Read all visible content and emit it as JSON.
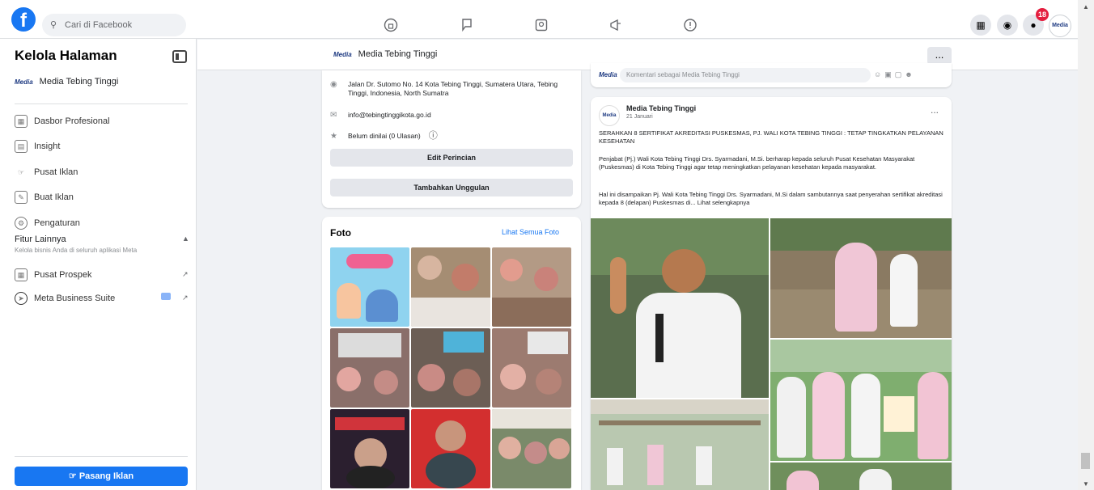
{
  "topbar": {
    "logo": "f",
    "search_placeholder": "Cari di Facebook",
    "profile_label": "Media",
    "notification_count": "18"
  },
  "sidebar": {
    "title": "Kelola Halaman",
    "page_name": "Media Tebing Tinggi",
    "page_logo_text": "Media",
    "items": [
      {
        "label": "Dasbor Profesional"
      },
      {
        "label": "Insight"
      },
      {
        "label": "Pusat Iklan"
      },
      {
        "label": "Buat Iklan"
      },
      {
        "label": "Pengaturan"
      }
    ],
    "section_title": "Fitur Lainnya",
    "section_subtitle": "Kelola bisnis Anda di seluruh aplikasi Meta",
    "extra_items": [
      {
        "label": "Pusat Prospek"
      },
      {
        "label": "Meta Business Suite"
      }
    ],
    "promote_button": "Pasang Iklan"
  },
  "page_bar": {
    "page_name": "Media Tebing Tinggi",
    "more_label": "..."
  },
  "intro": {
    "address": "Jalan Dr. Sutomo No. 14 Kota Tebing Tinggi, Sumatera Utara, Tebing Tinggi, Indonesia, North Sumatra",
    "email": "info@tebingtinggikota.go.id",
    "rating": "Belum dinilai (0 Ulasan)",
    "edit_button": "Edit Perincian",
    "add_featured_button": "Tambahkan Unggulan"
  },
  "photos": {
    "title": "Foto",
    "see_all": "Lihat Semua Foto"
  },
  "composer": {
    "placeholder": "Komentari sebagai Media Tebing Tinggi"
  },
  "post": {
    "author": "Media Tebing Tinggi",
    "date": "21 Januari",
    "more_label": "...",
    "headline": "SERAHKAN 8 SERTIFIKAT AKREDITASI PUSKESMAS, PJ. WALI KOTA TEBING TINGGI : TETAP TINGKATKAN PELAYANAN KESEHATAN",
    "paragraph1": "Penjabat (Pj.) Wali Kota Tebing Tinggi Drs. Syarmadani, M.Si. berharap kepada seluruh Pusat Kesehatan Masyarakat (Puskesmas) di Kota Tebing Tinggi agar tetap meningkatkan pelayanan kesehatan kepada masyarakat.",
    "paragraph2": "Hal ini disampaikan Pj. Wali Kota Tebing Tinggi Drs. Syarmadani, M.Si dalam sambutannya saat penyerahan sertifikat akreditasi kepada 8 (delapan) Puskesmas di... Lihat selengkapnya"
  }
}
